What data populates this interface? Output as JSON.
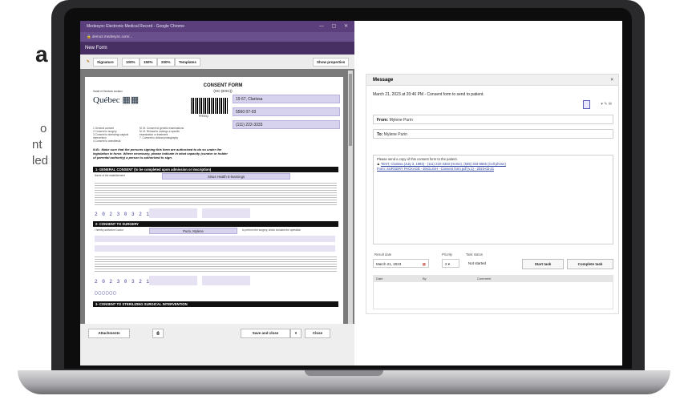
{
  "background_text": {
    "big_letter": "a",
    "lines": [
      "o",
      "nt",
      "led"
    ]
  },
  "browser": {
    "window_title": "Medesync Electronic Medical Record - Google Chrome",
    "url": "demo2.medesync.com/..."
  },
  "form_window": {
    "title": "New Form",
    "toolbar": {
      "signature_label": "Signature",
      "zoom_100": "100%",
      "zoom_150": "150%",
      "zoom_200": "200%",
      "templates_label": "Templates",
      "show_properties_label": "Show properties"
    },
    "footer": {
      "attachments_label": "Attachments",
      "save_close_label": "Save and close",
      "close_label": "Close"
    }
  },
  "document": {
    "title": "CONSENT FORM",
    "subtitle": "(HC-(EXC))",
    "logo_text": "Québec",
    "barcode_number": "FFEEQ",
    "patient_name": "19 67, Clarissa",
    "patient_dob": "5560 07-03",
    "patient_phone": "(111) 222-3333",
    "warning": "N.B.: Make sure that the persons signing this form are authorized to do so under the legislation in force. Where necessary, please indicate in what capacity (curator or holder of parental authority) a person is authorized to sign.",
    "section1": "1- GENERAL CONSENT (to be completed upon admission or inscription)",
    "section1_name": "Sirius Health E-learnings",
    "section1_digits": "2 0 2 3 0 3 2 1",
    "section2": "2- CONSENT TO SURGERY",
    "section2_name": "Purin, Mylene",
    "section2_digits": "2 0 2 3 0 3 2 1",
    "section3": "3- CONSENT TO STERILIZING SURGICAL INTERVENTION"
  },
  "message_panel": {
    "title": "Message",
    "subject": "March 21, 2023 at 20:46 PM - Consent form to send to patient.",
    "from_label": "From:",
    "from_value": "Mylene Purin",
    "to_label": "To:",
    "to_value": "Mylene Purin",
    "body_line1": "Please send a copy of this consent form to the patient.",
    "body_line2": "TEST, Clarissa (July 3, 1993) - (111) 222-3333 (Home), (555) 333-5555 (Cell phone)",
    "body_line3": "Form: SURGERY PACKAGE - ENGLISH - Consent form pdf (v.1) - 2023-03-21",
    "result_date_label": "Result date",
    "result_date_value": "March 21, 2023",
    "priority_label": "Priority",
    "priority_value": "2",
    "task_status_label": "Task status",
    "task_status_value": "Not started",
    "start_task_label": "Start task",
    "complete_task_label": "Complete task",
    "table_headers": [
      "Date",
      "By",
      "Comment"
    ]
  }
}
